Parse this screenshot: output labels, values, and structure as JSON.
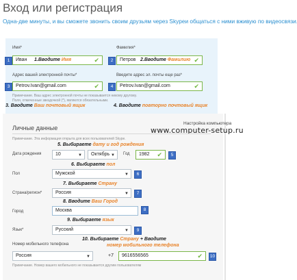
{
  "header": {
    "title": "Вход или регистрация",
    "subtitle": "Одна-две минуты, и вы сможете звонить своим друзьям через Skypeи общаться с ними вживую по видеосвязи."
  },
  "watermark": {
    "site": "www.computer-setup.ru",
    "tagline": "Настройка компьютера"
  },
  "form": {
    "first_name": {
      "label": "Имя*",
      "value": "Иван",
      "marker": "1",
      "ann_prefix": "1.Вводите ",
      "ann_hl": "Имя"
    },
    "last_name": {
      "label": "Фамилия*",
      "value": "Петров",
      "marker": "2",
      "ann_prefix": "2.Вводите ",
      "ann_hl": "Фамилию"
    },
    "email": {
      "label": "Адрес вашей электронной почты*",
      "value": "Petrov.Ivan@gmail.com",
      "marker": "3"
    },
    "email_repeat": {
      "label": "Введите адрес эл. почты еще раз*",
      "value": "Petrov.Ivan@gmail.com",
      "marker": "4"
    },
    "email_hint1": "Примечание. Ваш адрес электронной почты не показывается никому другому.",
    "email_hint2": "Поля, отмеченные звездочкой (*), являются обязательными.",
    "ann3_prefix": "3. Вводите ",
    "ann3_hl": "Ваш почтовый ящик",
    "ann4_prefix": "4. Вводите ",
    "ann4_hl": "повторно почтовый ящик"
  },
  "personal": {
    "section_title": "Личные данные",
    "note": "Примечание. Эта информация открыта для всех пользователей Skype.",
    "ann5_prefix": "5. Выбираете ",
    "ann5_hl": "дату и год рождения",
    "birth_label": "Дата рождения",
    "day": "10",
    "month": "Октябрь",
    "year_label": "Год",
    "year": "1982",
    "marker5": "5",
    "ann6_prefix": "6. Выбираете ",
    "ann6_hl": "пол",
    "gender_label": "Пол",
    "gender": "Мужской",
    "marker6": "6",
    "ann7_prefix": "7. Выбираете ",
    "ann7_hl": "Страну",
    "country_label": "Страна/регион*",
    "country": "Россия",
    "marker7": "7",
    "ann8_prefix": "8. Вводите ",
    "ann8_hl": "Ваш Город",
    "city_label": "Город",
    "city": "Москва",
    "marker8": "8",
    "ann9_prefix": "9. Выбираете ",
    "ann9_hl": "язык",
    "lang_label": "Язык*",
    "lang": "Русский",
    "marker9": "9",
    "ann10_line1_prefix": "10. Выбираете ",
    "ann10_line1_hl": "Страну",
    "ann10_line1_suffix": " + Вводите",
    "ann10_line2_hl": "номер мобильного телефона",
    "phone_label": "Номер мобильного телефона",
    "phone_country": "Россия",
    "phone_code": "+7",
    "phone": "9616556565",
    "marker10": "10",
    "phone_hint": "Примечание. Номер вашего мобильного не показывается другим пользователям"
  },
  "colors": {
    "accent": "#2b8fd0",
    "marker": "#3d6ec4",
    "highlight": "#e8832a",
    "valid": "#6fb63e"
  }
}
